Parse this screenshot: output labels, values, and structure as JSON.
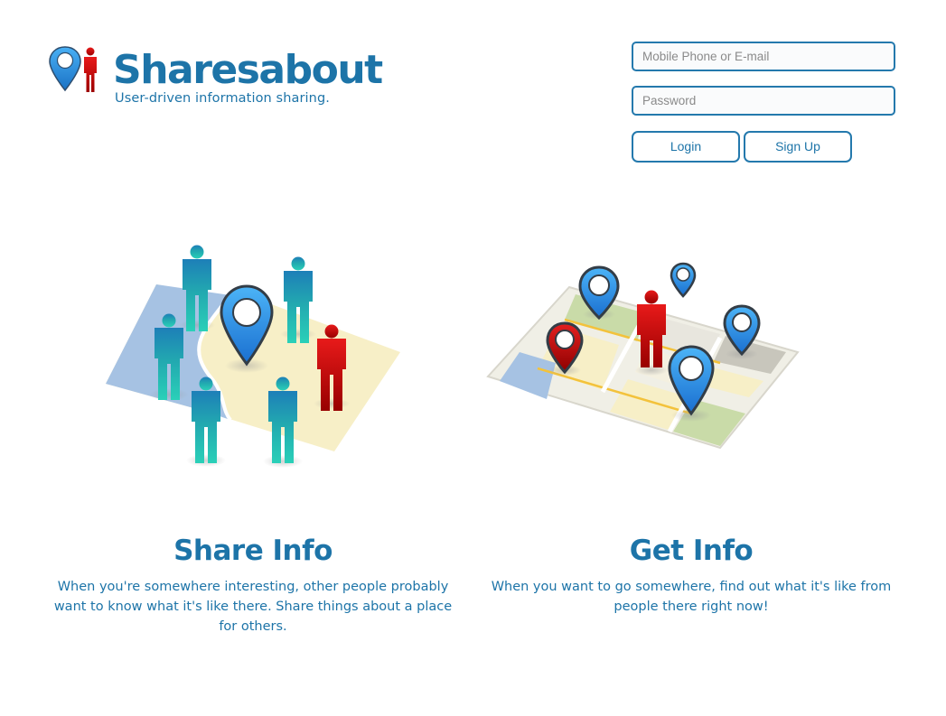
{
  "header": {
    "brand": "Sharesabout",
    "tagline": "User-driven information sharing.",
    "logo_icon": "map-pin-person-icon"
  },
  "login": {
    "email_placeholder": "Mobile Phone or E-mail",
    "email_value": "",
    "password_placeholder": "Password",
    "password_value": "",
    "login_label": "Login",
    "signup_label": "Sign Up"
  },
  "features": [
    {
      "title": "Share Info",
      "description": "When you're somewhere interesting, other people probably want to know what it's like there. Share things about a place for others.",
      "illustration": "people-on-map-illustration"
    },
    {
      "title": "Get Info",
      "description": "When you want to go somewhere, find out what it's like from people there right now!",
      "illustration": "pins-on-map-illustration"
    }
  ],
  "colors": {
    "brand_blue": "#1d74a8",
    "pin_blue": "#2c9af0",
    "person_red": "#d41414",
    "person_teal": "#24b6b0",
    "map_blue": "#a7c4e4",
    "map_cream": "#f8f0c8",
    "map_green": "#c9dba8"
  }
}
